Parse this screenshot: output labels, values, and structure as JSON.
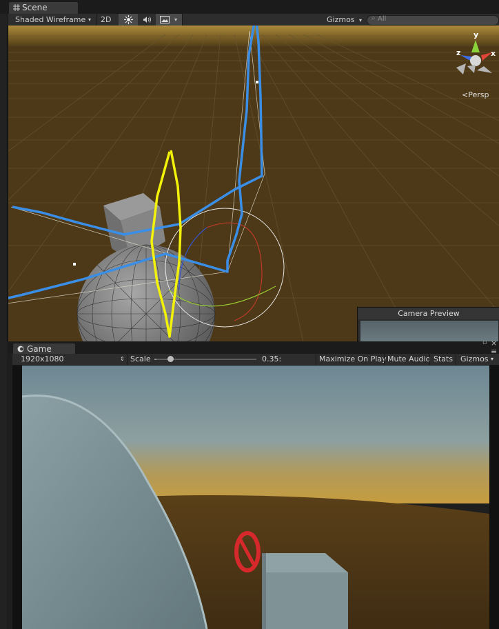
{
  "scene": {
    "tab_label": "Scene",
    "draw_mode": "Shaded Wireframe",
    "mode_2d": "2D",
    "gizmos_label": "Gizmos",
    "search_placeholder": "All",
    "projection_label": "Persp",
    "axis_labels": {
      "x": "x",
      "y": "y",
      "z": "z"
    }
  },
  "camera_preview": {
    "title": "Camera Preview"
  },
  "game": {
    "tab_label": "Game",
    "resolution": "1920x1080",
    "scale_label": "Scale",
    "scale_value": "0.35:",
    "scale_level": 0.02,
    "maximize_label": "Maximize On Play",
    "mute_label": "Mute Audio",
    "stats_label": "Stats",
    "gizmos_label": "Gizmos"
  },
  "colors": {
    "sky_top": "#2b2b2b",
    "ground": "#4c3818",
    "annotation_blue": "#3a8ee6",
    "annotation_yellow": "#f2f20a",
    "game_sky": "#6a8490",
    "game_ground": "#4a3416"
  },
  "icons": [
    "scene-grid-icon",
    "sun-icon",
    "audio-icon",
    "image-icon",
    "search-icon",
    "game-controller-icon",
    "no-entry-icon",
    "maximize-icon",
    "close-icon",
    "menu-icon"
  ]
}
